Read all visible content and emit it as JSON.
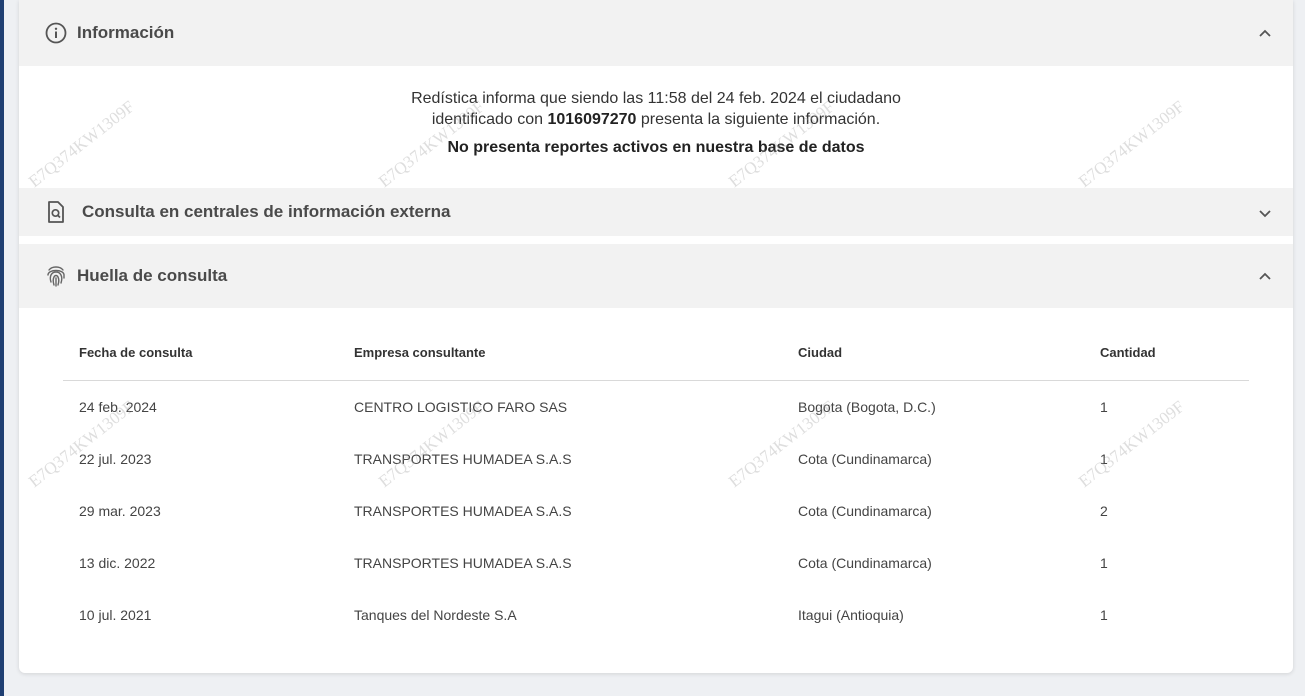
{
  "colors": {
    "page_bg": "#eef0f3",
    "header_bg": "#f2f2f2",
    "left_accent": "#1f3f72"
  },
  "info_section": {
    "title": "Información",
    "icon": "info-circle-icon",
    "expanded": true,
    "line1": "Redística informa que siendo las 11:58 del 24 feb. 2024 el ciudadano",
    "line2_prefix": "identificado con ",
    "id_number": "1016097270",
    "line2_suffix": " presenta la siguiente información.",
    "status": "No presenta reportes activos en nuestra base de datos"
  },
  "external_section": {
    "title": "Consulta en centrales de información externa",
    "icon": "document-search-icon",
    "expanded": false
  },
  "footprint_section": {
    "title": "Huella de consulta",
    "icon": "fingerprint-icon",
    "expanded": true,
    "headers": [
      "Fecha de consulta",
      "Empresa consultante",
      "Ciudad",
      "Cantidad"
    ],
    "rows": [
      [
        "24 feb. 2024",
        "CENTRO LOGISTICO FARO SAS",
        "Bogota (Bogota, D.C.)",
        "1"
      ],
      [
        "22 jul. 2023",
        "TRANSPORTES HUMADEA S.A.S",
        "Cota (Cundinamarca)",
        "1"
      ],
      [
        "29 mar. 2023",
        "TRANSPORTES HUMADEA S.A.S",
        "Cota (Cundinamarca)",
        "2"
      ],
      [
        "13 dic. 2022",
        "TRANSPORTES HUMADEA S.A.S",
        "Cota (Cundinamarca)",
        "1"
      ],
      [
        "10 jul. 2021",
        "Tanques del Nordeste S.A",
        "Itagui (Antioquia)",
        "1"
      ]
    ]
  },
  "watermark": "E7Q374KW1309F"
}
